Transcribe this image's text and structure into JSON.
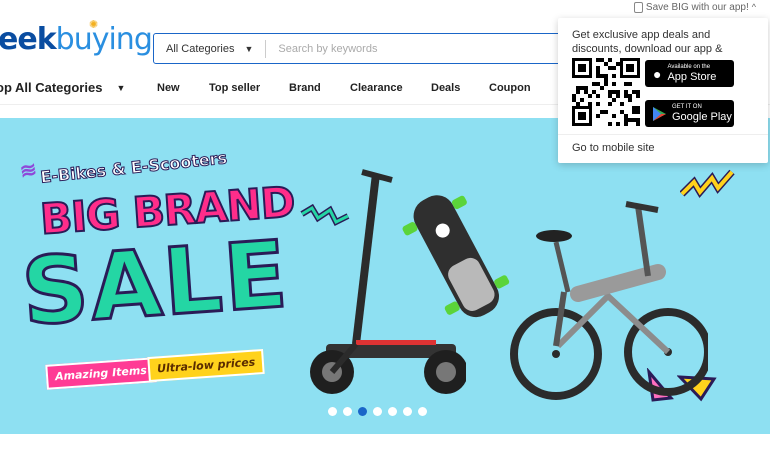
{
  "topbar": {
    "app_promo": "Save BIG with our app!"
  },
  "header": {
    "logo": {
      "dark": "eek",
      "light": "buying"
    },
    "search": {
      "category": "All Categories",
      "placeholder": "Search by keywords"
    }
  },
  "nav": {
    "all_categories": "op All Categories",
    "links": [
      "New",
      "Top seller",
      "Brand",
      "Clearance",
      "Deals",
      "Coupon"
    ]
  },
  "banner": {
    "subtitle": "E-Bikes & E-Scooters",
    "big_brand": "BIG BRAND",
    "sale": "SALE",
    "tag_left": "Amazing Items",
    "tag_right": "Ultra-low prices",
    "carousel": {
      "count": 7,
      "active": 3
    }
  },
  "popover": {
    "title": "Get exclusive app deals and discounts, download our app & SAVE",
    "apple": {
      "small": "Available on the",
      "big": "App Store"
    },
    "google": {
      "small": "GET IT ON",
      "big": "Google Play"
    },
    "mobile_link": "Go to mobile site"
  },
  "colors": {
    "brand_blue": "#0a4da1",
    "search_border": "#1a66c8",
    "banner_bg": "#8ee0f2",
    "sale_green": "#24d6a4",
    "big_brand_pink": "#ff2d8a"
  }
}
